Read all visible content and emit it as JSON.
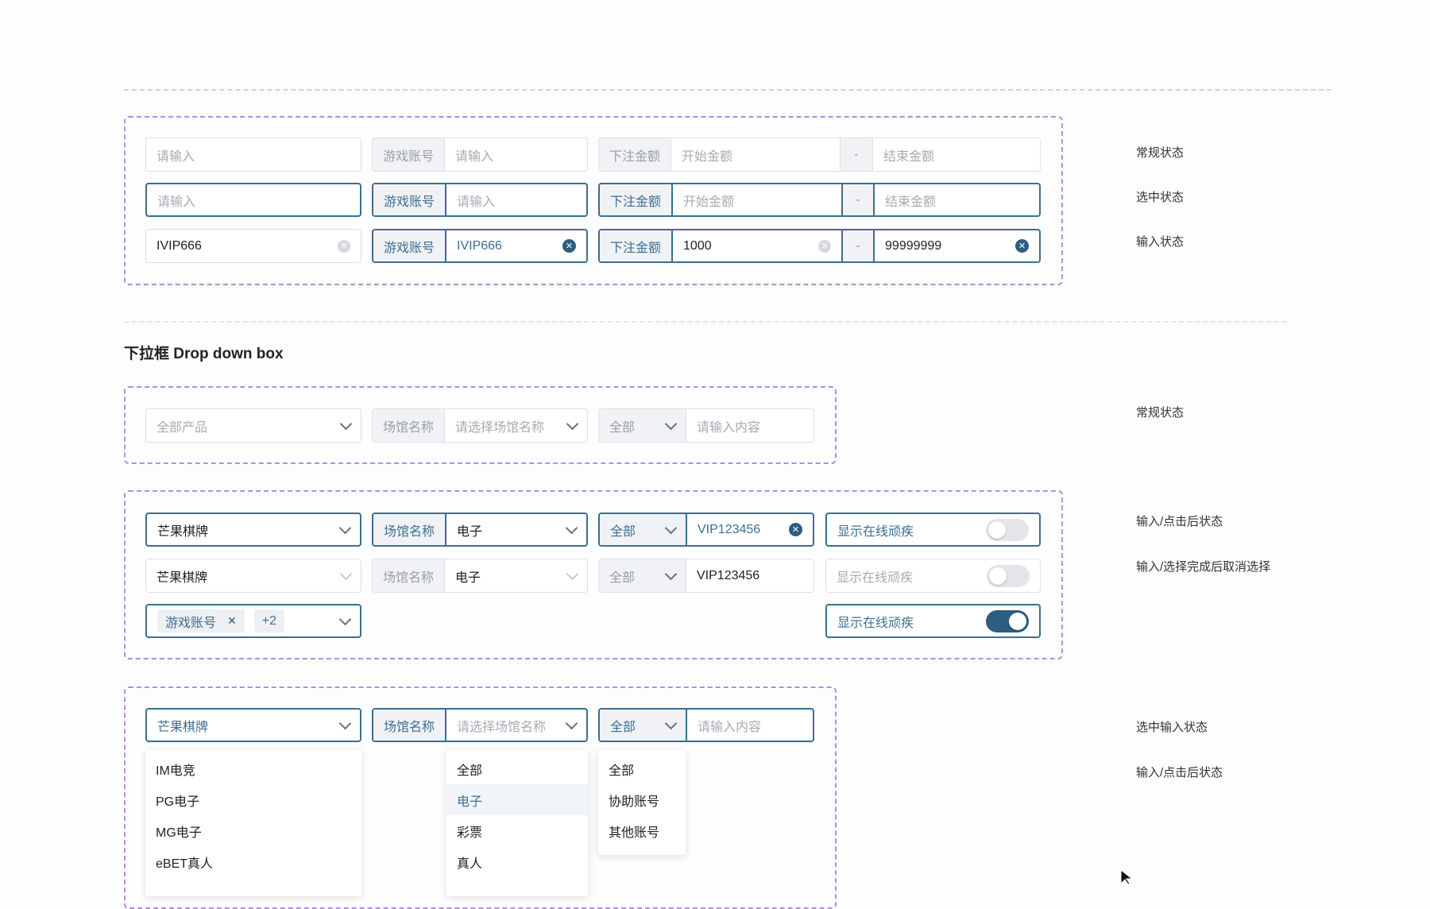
{
  "section1": {
    "row1": {
      "plain_placeholder": "请输入",
      "account_prefix": "游戏账号",
      "account_placeholder": "请输入",
      "amount_prefix": "下注金额",
      "amount_start_placeholder": "开始金额",
      "amount_sep": "-",
      "amount_end_placeholder": "结束金额"
    },
    "row2": {
      "plain_placeholder": "请输入",
      "account_prefix": "游戏账号",
      "account_placeholder": "请输入",
      "amount_prefix": "下注金额",
      "amount_start_placeholder": "开始金额",
      "amount_sep": "-",
      "amount_end_placeholder": "结束金额"
    },
    "row3": {
      "plain_value": "IVIP666",
      "account_prefix": "游戏账号",
      "account_value": "IVIP666",
      "amount_prefix": "下注金额",
      "amount_start_value": "1000",
      "amount_sep": "-",
      "amount_end_value": "99999999"
    },
    "labels": [
      "常规状态",
      "选中状态",
      "输入状态"
    ]
  },
  "dropdown_section": {
    "title": "下拉框 Drop down box",
    "normal": {
      "product_placeholder": "全部产品",
      "venue_prefix": "场馆名称",
      "venue_placeholder": "请选择场馆名称",
      "scope_value": "全部",
      "search_placeholder": "请输入内容",
      "label": "常规状态"
    },
    "clicked": {
      "row1": {
        "product_value": "芒果棋牌",
        "venue_prefix": "场馆名称",
        "venue_value": "电子",
        "scope_value": "全部",
        "search_value": "VIP123456",
        "toggle_label": "显示在线顽疾",
        "toggle_on": false
      },
      "row2": {
        "product_value": "芒果棋牌",
        "venue_prefix": "场馆名称",
        "venue_value": "电子",
        "scope_value": "全部",
        "search_value": "VIP123456",
        "toggle_label": "显示在线顽疾",
        "toggle_on": false
      },
      "row3": {
        "tag_label": "游戏账号",
        "tag_close": "✕",
        "more_count": "+2",
        "toggle_label": "显示在线顽疾",
        "toggle_on": true
      },
      "labels": [
        "输入/点击后状态",
        "输入/选择完成后取消选择"
      ]
    },
    "selected": {
      "product_value": "芒果棋牌",
      "venue_prefix": "场馆名称",
      "venue_placeholder": "请选择场馆名称",
      "scope_value": "全部",
      "search_placeholder": "请输入内容",
      "labels": [
        "选中输入状态",
        "输入/点击后状态"
      ],
      "product_options": [
        "IM电竞",
        "PG电子",
        "MG电子",
        "eBET真人"
      ],
      "venue_options": [
        "全部",
        "电子",
        "彩票",
        "真人"
      ],
      "venue_selected": "电子",
      "scope_options": [
        "全部",
        "协助账号",
        "其他账号"
      ]
    }
  },
  "colors": {
    "accent": "#3b6f91",
    "frame_dash": "#b98be0",
    "border": "#dcdfe6",
    "prefix_bg": "#f1f2f5"
  }
}
